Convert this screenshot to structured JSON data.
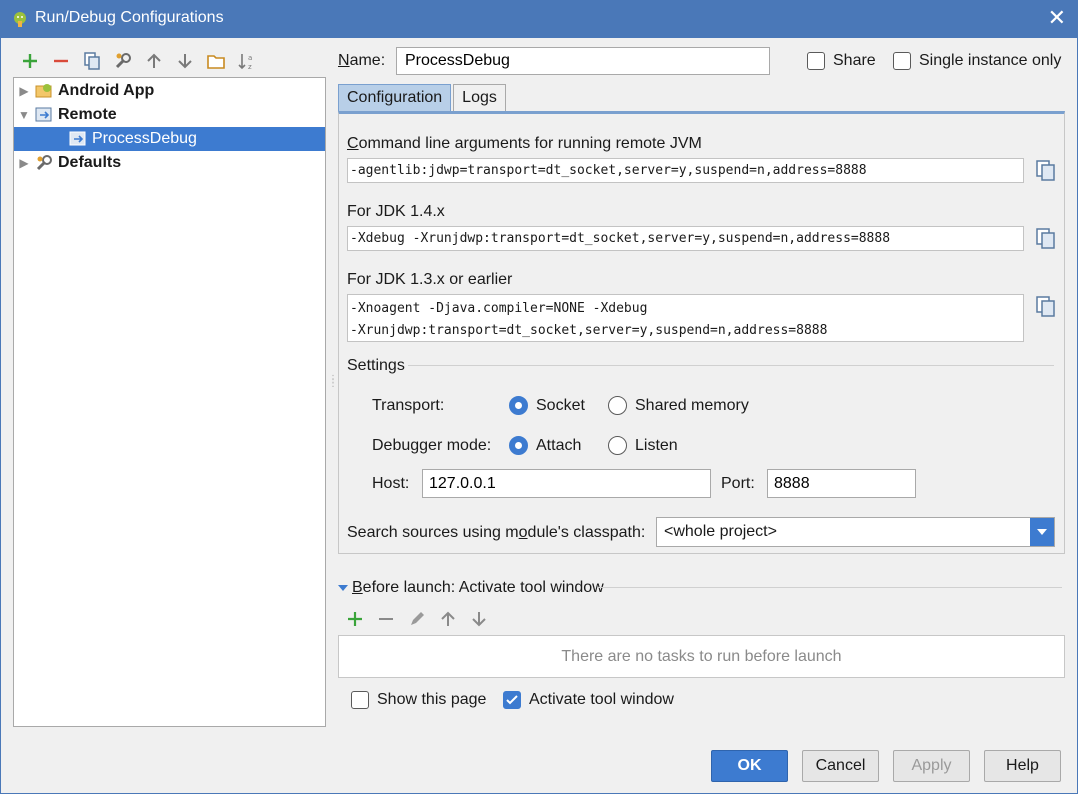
{
  "window": {
    "title": "Run/Debug Configurations"
  },
  "left_toolbar": [
    "add-icon",
    "remove-icon",
    "copy-icon",
    "wrench-icon",
    "arrow-up-icon",
    "arrow-down-icon",
    "folder-icon",
    "sort-az-icon"
  ],
  "tree": [
    {
      "label": "Android App",
      "bold": true,
      "expanded": false
    },
    {
      "label": "Remote",
      "bold": true,
      "expanded": true
    },
    {
      "label": "ProcessDebug",
      "bold": false,
      "selected": true
    },
    {
      "label": "Defaults",
      "bold": true,
      "expanded": false
    }
  ],
  "name": {
    "label_mnemonic": "N",
    "label_rest": "ame:",
    "value": "ProcessDebug"
  },
  "share": {
    "label": "Share",
    "checked": false
  },
  "single_instance": {
    "label": "Single instance only",
    "checked": false
  },
  "tabs": [
    {
      "label": "Configuration",
      "active": true
    },
    {
      "label": "Logs",
      "active": false
    }
  ],
  "jvm": {
    "label_mnemonic": "C",
    "label_rest": "ommand line arguments for running remote JVM",
    "value": "-agentlib:jdwp=transport=dt_socket,server=y,suspend=n,address=8888"
  },
  "jdk14": {
    "label": "For JDK 1.4.x",
    "value": "-Xdebug -Xrunjdwp:transport=dt_socket,server=y,suspend=n,address=8888"
  },
  "jdk13": {
    "label": "For JDK 1.3.x or earlier",
    "line1": "-Xnoagent -Djava.compiler=NONE -Xdebug",
    "line2": "-Xrunjdwp:transport=dt_socket,server=y,suspend=n,address=8888"
  },
  "settings": {
    "label": "Settings",
    "transport": {
      "label": "Transport:",
      "options": [
        "Socket",
        "Shared memory"
      ],
      "selected": "Socket"
    },
    "debugger_mode": {
      "label": "Debugger mode:",
      "options": [
        "Attach",
        "Listen"
      ],
      "selected": "Attach"
    },
    "host": {
      "label": "Host:",
      "value": "127.0.0.1"
    },
    "port": {
      "label": "Port:",
      "value": "8888"
    },
    "classpath": {
      "label_pre": "Search sources using m",
      "label_mnemonic": "o",
      "label_post": "dule's classpath:",
      "value": "<whole project>"
    }
  },
  "before_launch": {
    "mnemonic": "B",
    "title_rest": "efore launch: Activate tool window",
    "empty_text": "There are no tasks to run before launch",
    "toolbar": [
      "add-icon",
      "remove-icon",
      "edit-icon",
      "arrow-up-icon",
      "arrow-down-icon"
    ]
  },
  "show_page": {
    "label": "Show this page",
    "checked": false
  },
  "activate_window": {
    "label": "Activate tool window",
    "checked": true
  },
  "buttons": {
    "ok": "OK",
    "cancel": "Cancel",
    "apply": "Apply",
    "help": "Help"
  },
  "colors": {
    "accent": "#3d7bd0",
    "titlebar": "#4a78b8"
  }
}
